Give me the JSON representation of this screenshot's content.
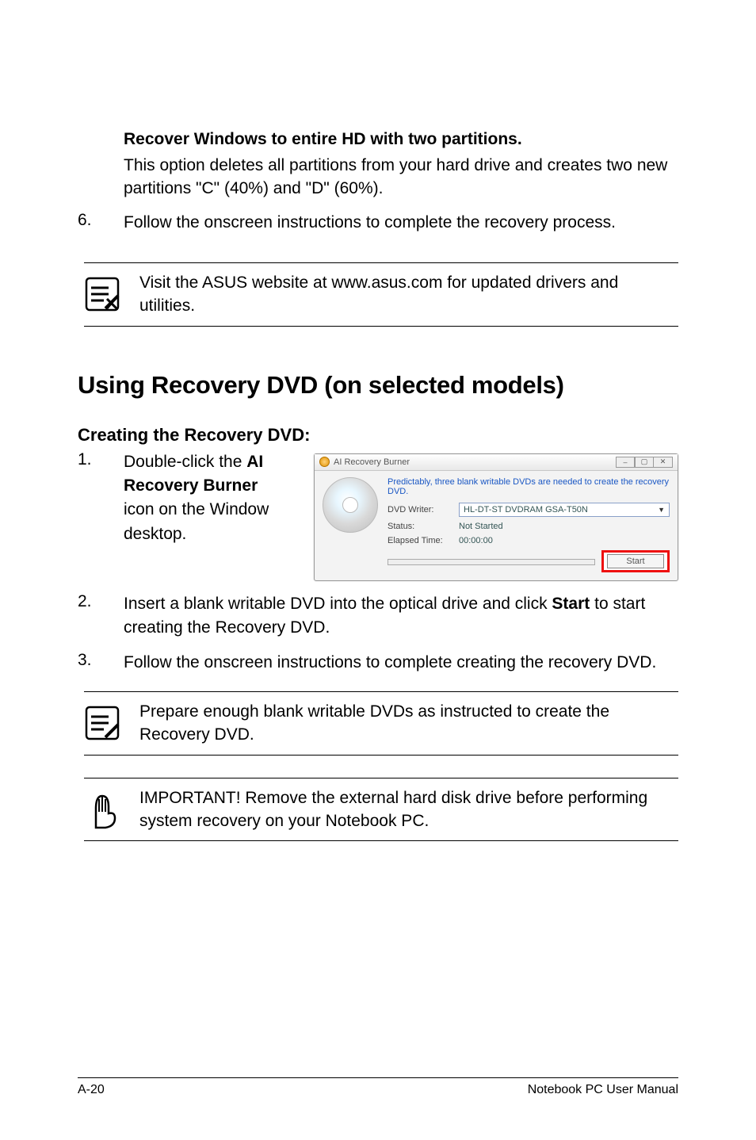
{
  "option": {
    "title": "Recover Windows to entire HD with two partitions.",
    "desc": "This option deletes all partitions from your hard drive and creates two new partitions \"C\" (40%) and \"D\" (60%)."
  },
  "step6": {
    "num": "6.",
    "text": "Follow the onscreen instructions to complete the recovery process."
  },
  "note_visit": "Visit the ASUS website at www.asus.com for updated drivers and utilities.",
  "section_title": "Using Recovery DVD (on selected models)",
  "subsection_title": "Creating the Recovery DVD:",
  "steps_dvd": {
    "s1": {
      "num": "1.",
      "lead": "Double-click the ",
      "bold": "AI Recovery Burner",
      "tail": " icon on the Window desktop."
    },
    "s2": {
      "num": "2.",
      "lead": "Insert a blank writable DVD into the optical drive and click ",
      "bold": "Start",
      "tail": " to start creating the Recovery DVD."
    },
    "s3": {
      "num": "3.",
      "text": "Follow the onscreen instructions to complete creating the recovery DVD."
    }
  },
  "note_prepare": "Prepare enough blank writable DVDs as instructed to create the Recovery DVD.",
  "note_important": "IMPORTANT! Remove the external hard disk drive before performing system recovery on your Notebook PC.",
  "shot": {
    "window_title": "AI Recovery Burner",
    "hint": "Predictably, three blank writable DVDs are needed to create the recovery DVD.",
    "label_writer": "DVD Writer:",
    "writer_value": "HL-DT-ST DVDRAM GSA-T50N",
    "label_status": "Status:",
    "status_value": "Not Started",
    "label_elapsed": "Elapsed Time:",
    "elapsed_value": "00:00:00",
    "start_button": "Start"
  },
  "footer": {
    "left": "A-20",
    "right": "Notebook PC User Manual"
  },
  "icons": {
    "note": "note-icon",
    "hand": "caution-hand-icon"
  }
}
